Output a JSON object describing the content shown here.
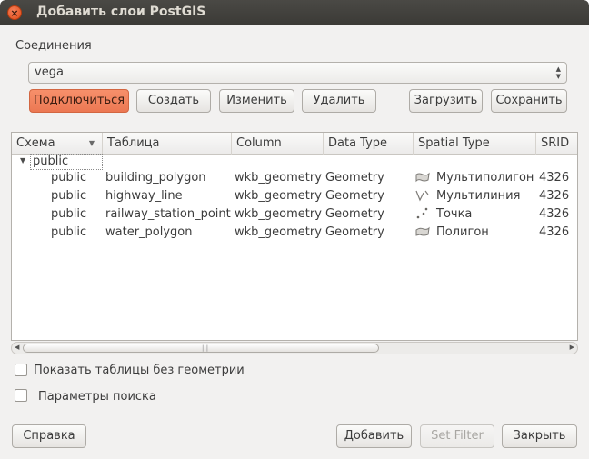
{
  "window": {
    "title": "Добавить слои PostGIS",
    "close_glyph": "×"
  },
  "connections": {
    "label": "Соединения",
    "selected": "vega",
    "buttons": {
      "connect": "Подключиться",
      "create": "Создать",
      "edit": "Изменить",
      "delete": "Удалить",
      "load": "Загрузить",
      "save": "Сохранить"
    }
  },
  "table": {
    "columns": [
      "Схема",
      "Таблица",
      "Column",
      "Data Type",
      "Spatial Type",
      "SRID"
    ],
    "group": "public",
    "rows": [
      {
        "schema": "public",
        "table": "building_polygon",
        "column": "wkb_geometry",
        "data_type": "Geometry",
        "spatial_type": "Мультиполигон",
        "icon": "multipolygon-icon",
        "srid": "4326"
      },
      {
        "schema": "public",
        "table": "highway_line",
        "column": "wkb_geometry",
        "data_type": "Geometry",
        "spatial_type": "Мультилиния",
        "icon": "multiline-icon",
        "srid": "4326"
      },
      {
        "schema": "public",
        "table": "railway_station_point",
        "column": "wkb_geometry",
        "data_type": "Geometry",
        "spatial_type": "Точка",
        "icon": "point-icon",
        "srid": "4326"
      },
      {
        "schema": "public",
        "table": "water_polygon",
        "column": "wkb_geometry",
        "data_type": "Geometry",
        "spatial_type": "Полигон",
        "icon": "polygon-icon",
        "srid": "4326"
      }
    ]
  },
  "options": {
    "show_no_geometry": {
      "label": "Показать таблицы без геометрии",
      "checked": false
    },
    "search_options": {
      "label": "Параметры поиска",
      "checked": false
    }
  },
  "footer": {
    "help": "Справка",
    "add": "Добавить",
    "set_filter": "Set Filter",
    "close": "Закрыть"
  }
}
